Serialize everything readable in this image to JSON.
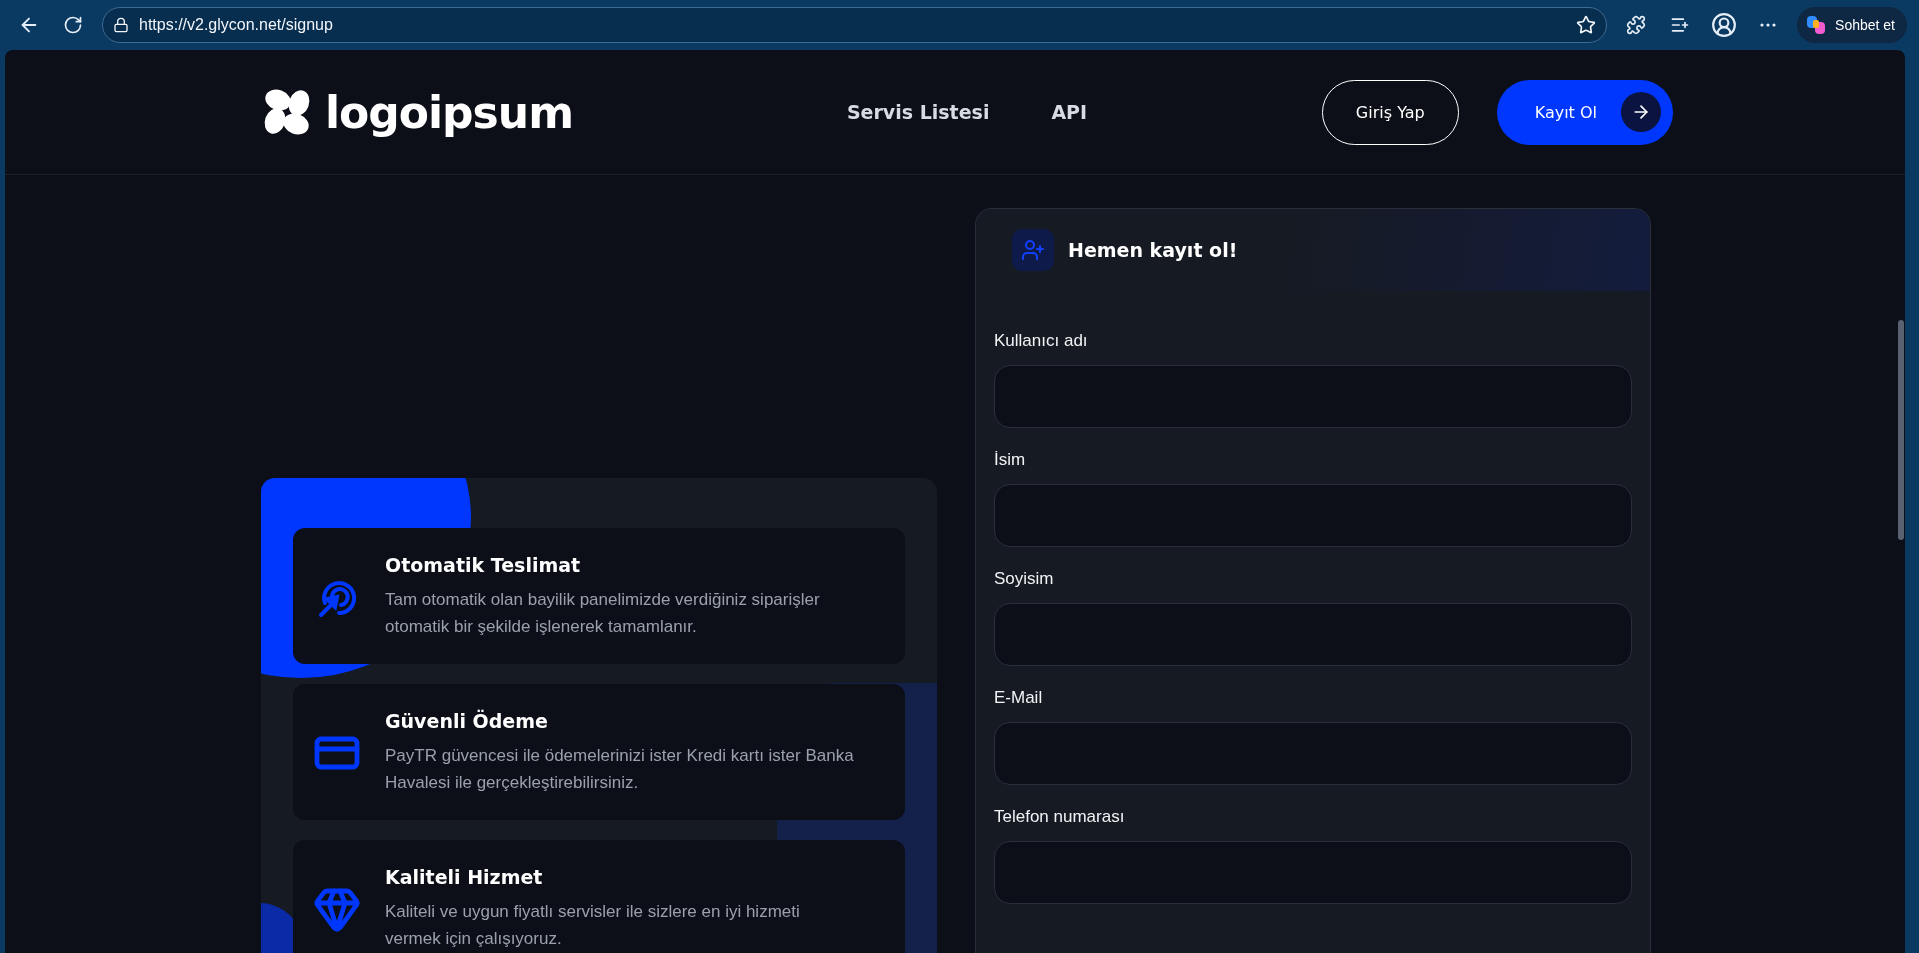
{
  "browser": {
    "url": "https://v2.glycon.net/signup",
    "copilot_label": "Sohbet et"
  },
  "header": {
    "logo": "logoipsum",
    "nav": [
      "Servis Listesi",
      "API"
    ],
    "login_button": "Giriş Yap",
    "signup_button": "Kayıt Ol"
  },
  "features": [
    {
      "kind": "target",
      "title": "Otomatik Teslimat",
      "description": "Tam otomatik olan bayilik panelimizde verdiğiniz siparişler otomatik bir şekilde işlenerek tamamlanır."
    },
    {
      "kind": "card",
      "title": "Güvenli Ödeme",
      "description": "PayTR güvencesi ile ödemelerinizi ister Kredi kartı ister Banka Havalesi ile gerçekleştirebilirsiniz."
    },
    {
      "kind": "diamond",
      "title": "Kaliteli Hizmet",
      "description": "Kaliteli ve uygun fiyatlı servisler ile sizlere en iyi hizmeti vermek için çalışıyoruz."
    }
  ],
  "signup": {
    "title": "Hemen kayıt ol!",
    "fields": [
      {
        "label": "Kullanıcı adı"
      },
      {
        "label": "İsim"
      },
      {
        "label": "Soyisim"
      },
      {
        "label": "E-Mail"
      },
      {
        "label": "Telefon numarası"
      }
    ]
  }
}
